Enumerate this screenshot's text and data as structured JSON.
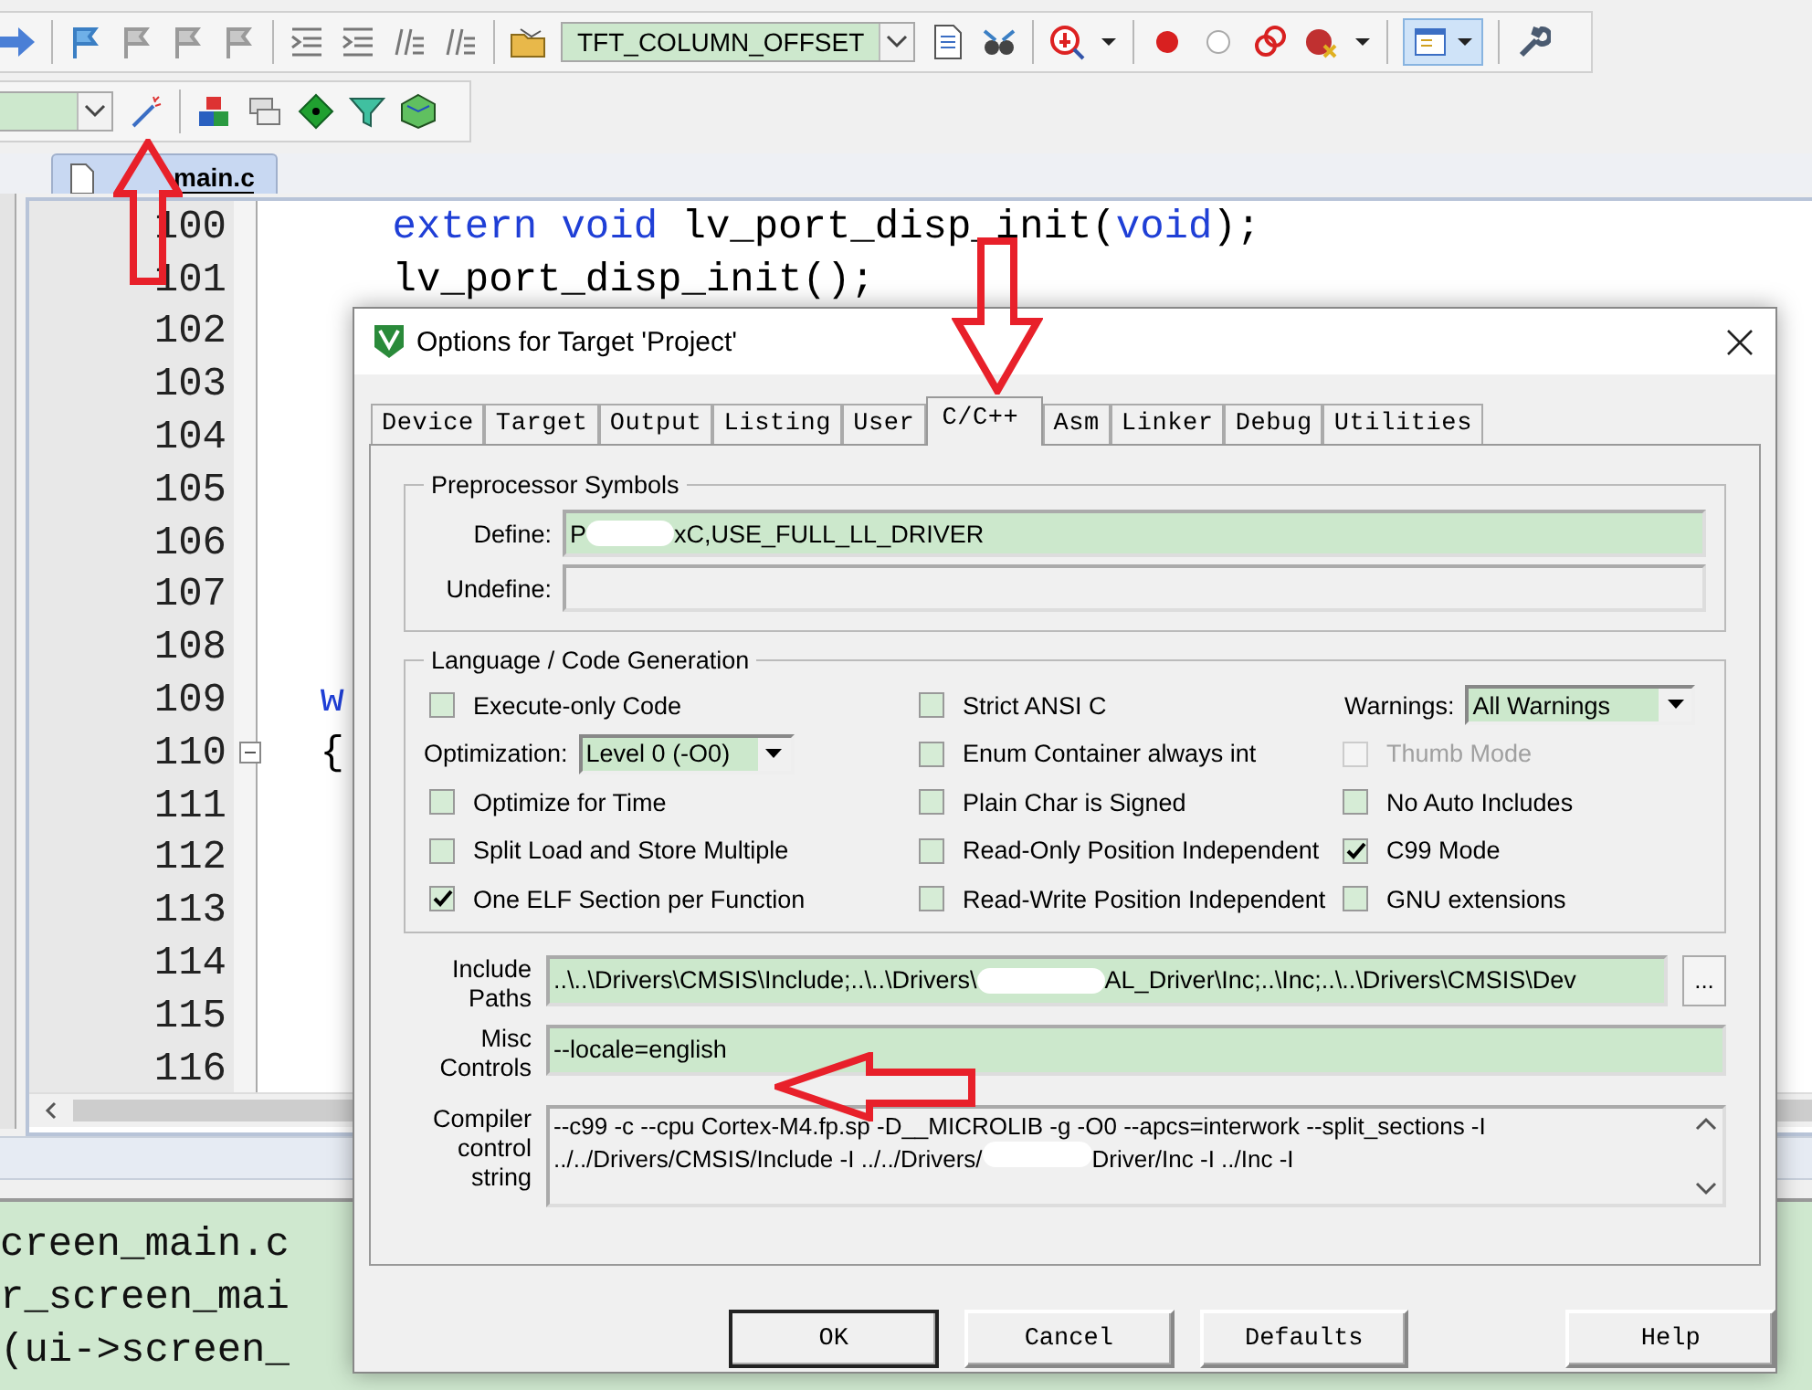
{
  "toolbar": {
    "target_combo": "TFT_COLUMN_OFFSET"
  },
  "file_tab": {
    "label": "main.c",
    "selected": true
  },
  "editor": {
    "lines": [
      {
        "number": "100",
        "fold": false,
        "code": [
          {
            "text": "    extern void",
            "keyword": true
          },
          {
            "text": " lv_port_disp_init(",
            "keyword": false
          },
          {
            "text": "void",
            "keyword": true
          },
          {
            "text": ");",
            "keyword": false
          }
        ]
      },
      {
        "number": "101",
        "fold": false,
        "code": [
          {
            "text": "    lv_port_disp_init();",
            "keyword": false
          }
        ]
      },
      {
        "number": "102",
        "fold": false
      },
      {
        "number": "103",
        "fold": false
      },
      {
        "number": "104",
        "fold": false
      },
      {
        "number": "105",
        "fold": false
      },
      {
        "number": "106",
        "fold": false
      },
      {
        "number": "107",
        "fold": false
      },
      {
        "number": "108",
        "fold": false
      },
      {
        "number": "109",
        "fold": false,
        "code": [
          {
            "text": " w",
            "keyword": true
          }
        ]
      },
      {
        "number": "110",
        "fold": true,
        "code": [
          {
            "text": " {",
            "keyword": false
          }
        ]
      },
      {
        "number": "111",
        "fold": false
      },
      {
        "number": "112",
        "fold": false
      },
      {
        "number": "113",
        "fold": false
      },
      {
        "number": "114",
        "fold": false
      },
      {
        "number": "115",
        "fold": false
      },
      {
        "number": "116",
        "fold": false
      }
    ]
  },
  "output": {
    "lines": [
      "creen_main.c",
      "r_screen_mai",
      "(ui->screen_"
    ]
  },
  "dialog": {
    "title": "Options for Target 'Project'",
    "tabs": [
      {
        "label": "Device",
        "selected": false
      },
      {
        "label": "Target",
        "selected": false
      },
      {
        "label": "Output",
        "selected": false
      },
      {
        "label": "Listing",
        "selected": false
      },
      {
        "label": "User",
        "selected": false
      },
      {
        "label": "C/C++",
        "selected": true
      },
      {
        "label": "Asm",
        "selected": false
      },
      {
        "label": "Linker",
        "selected": false
      },
      {
        "label": "Debug",
        "selected": false
      },
      {
        "label": "Utilities",
        "selected": false
      }
    ],
    "preprocessor": {
      "title": "Preprocessor Symbols",
      "define": {
        "label": "Define:",
        "segments": [
          "P",
          "xC,USE_FULL_LL_DRIVER"
        ]
      },
      "undefine": {
        "label": "Undefine:"
      }
    },
    "language": {
      "title": "Language / Code Generation",
      "columns": [
        [
          {
            "kind": "checkbox",
            "label": "Execute-only Code",
            "checked": false,
            "disabled": false
          },
          {
            "kind": "select",
            "label": "Optimization:",
            "value": "Level 0 (-O0)"
          },
          {
            "kind": "checkbox",
            "label": "Optimize for Time",
            "checked": false,
            "disabled": false
          },
          {
            "kind": "checkbox",
            "label": "Split Load and Store Multiple",
            "checked": false,
            "disabled": false
          },
          {
            "kind": "checkbox",
            "label": "One ELF Section per Function",
            "checked": true,
            "disabled": false
          }
        ],
        [
          {
            "kind": "checkbox",
            "label": "Strict ANSI C",
            "checked": false,
            "disabled": false
          },
          {
            "kind": "checkbox",
            "label": "Enum Container always int",
            "checked": false,
            "disabled": false
          },
          {
            "kind": "checkbox",
            "label": "Plain Char is Signed",
            "checked": false,
            "disabled": false
          },
          {
            "kind": "checkbox",
            "label": "Read-Only Position Independent",
            "checked": false,
            "disabled": false
          },
          {
            "kind": "checkbox",
            "label": "Read-Write Position Independent",
            "checked": false,
            "disabled": false
          }
        ],
        [
          {
            "kind": "select",
            "label": "Warnings:",
            "value": "All Warnings"
          },
          {
            "kind": "checkbox",
            "label": "Thumb Mode",
            "checked": false,
            "disabled": true
          },
          {
            "kind": "checkbox",
            "label": "No Auto Includes",
            "checked": false,
            "disabled": false
          },
          {
            "kind": "checkbox",
            "label": "C99 Mode",
            "checked": true,
            "disabled": false
          },
          {
            "kind": "checkbox",
            "label": "GNU extensions",
            "checked": false,
            "disabled": false
          }
        ]
      ]
    },
    "include": {
      "label": "Include Paths",
      "segments": [
        "..\\..\\Drivers\\CMSIS\\Include;..\\..\\Drivers\\",
        "AL_Driver\\Inc;..\\Inc;..\\..\\Drivers\\CMSIS\\Dev"
      ],
      "browse": "..."
    },
    "misc": {
      "label": "Misc Controls",
      "value": "--locale=english"
    },
    "compiler": {
      "label": "Compiler control string",
      "lines": [
        [
          "--c99 -c --cpu Cortex-M4.fp.sp -D__MICROLIB -g -O0 --apcs=interwork --split_sections -I"
        ],
        [
          "../../Drivers/CMSIS/Include -I ../../Drivers/",
          "Driver/Inc -I ../Inc -I"
        ]
      ]
    },
    "buttons": [
      "OK",
      "Cancel",
      "Defaults",
      "Help"
    ]
  }
}
